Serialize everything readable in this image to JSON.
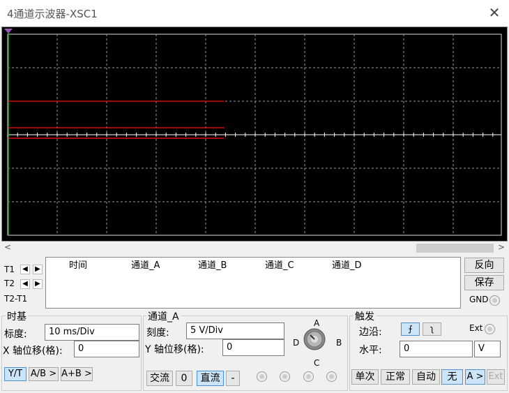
{
  "window": {
    "title": "4通道示波器-XSC1"
  },
  "cursors": {
    "t1": "T1",
    "t2": "T2",
    "diff": "T2-T1"
  },
  "readout": {
    "headers": [
      "时间",
      "通道_A",
      "通道_B",
      "通道_C",
      "通道_D"
    ]
  },
  "side_buttons": {
    "reverse": "反向",
    "save": "保存",
    "gnd": "GND"
  },
  "timebase": {
    "title": "时基",
    "scale_label": "标度:",
    "scale_value": "10 ms/Div",
    "xpos_label": "X 轴位移(格):",
    "xpos_value": "0",
    "modes": [
      "Y/T",
      "A/B >",
      "A+B >"
    ]
  },
  "channel": {
    "title": "通道_A",
    "scale_label": "刻度:",
    "scale_value": "5  V/Div",
    "ypos_label": "Y 轴位移(格):",
    "ypos_value": "0",
    "coupling": [
      "交流",
      "0",
      "直流",
      "-"
    ],
    "knob_labels": {
      "a": "A",
      "b": "B",
      "c": "C",
      "d": "D"
    }
  },
  "trigger": {
    "title": "触发",
    "edge_label": "边沿:",
    "ext_label": "Ext",
    "level_label": "水平:",
    "level_value": "0",
    "level_unit": "V",
    "modes": [
      "单次",
      "正常",
      "自动",
      "无",
      "A >",
      "Ext"
    ]
  },
  "colors": {
    "screen": "#000000",
    "trace": "#d01010",
    "grid": "#bbbbbb",
    "cursor": "#22aa22"
  }
}
